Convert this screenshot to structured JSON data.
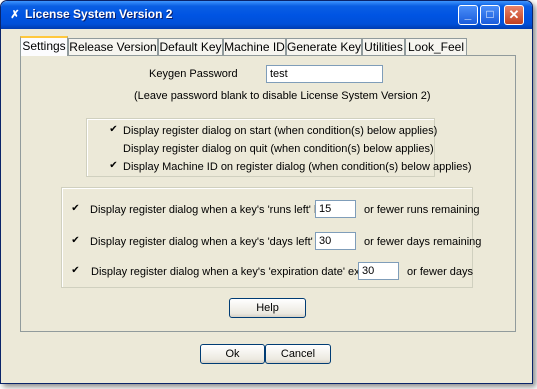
{
  "window": {
    "title": "License System Version 2",
    "controls": {
      "minimize": "_",
      "maximize": "□",
      "close": "✕"
    }
  },
  "tabs": [
    {
      "label": "Settings",
      "active": true
    },
    {
      "label": "Release Version",
      "active": false
    },
    {
      "label": "Default Key",
      "active": false
    },
    {
      "label": "Machine ID",
      "active": false
    },
    {
      "label": "Generate Key",
      "active": false
    },
    {
      "label": "Utilities",
      "active": false
    },
    {
      "label": "Look_Feel",
      "active": false
    }
  ],
  "settings": {
    "keygen_password_label": "Keygen Password",
    "keygen_password_value": "test",
    "password_hint": "(Leave password blank to disable License System Version 2)",
    "dialog_options": [
      {
        "label": "Display register dialog on start (when condition(s) below applies)",
        "checked": true
      },
      {
        "label": "Display register dialog on quit (when condition(s) below applies)",
        "checked": false
      },
      {
        "label": "Display Machine ID on register dialog (when condition(s) below applies)",
        "checked": true
      }
    ],
    "conditions": [
      {
        "label": "Display register dialog when a key's 'runs left' has",
        "value": "15",
        "suffix": "or fewer runs remaining",
        "checked": true
      },
      {
        "label": "Display register dialog when a key's 'days left' has",
        "value": "30",
        "suffix": "or fewer days remaining",
        "checked": true
      },
      {
        "label": "Display register dialog when a key's 'expiration date' expires",
        "value": "30",
        "suffix": "or fewer days",
        "checked": true
      }
    ],
    "help_label": "Help"
  },
  "footer": {
    "ok_label": "Ok",
    "cancel_label": "Cancel"
  },
  "colors": {
    "title_bar": "#0054e3",
    "dialog_bg": "#ece9d8",
    "active_tab_accent": "#ffc83c"
  },
  "icons": {
    "app": "app-icon",
    "check": "✔"
  }
}
